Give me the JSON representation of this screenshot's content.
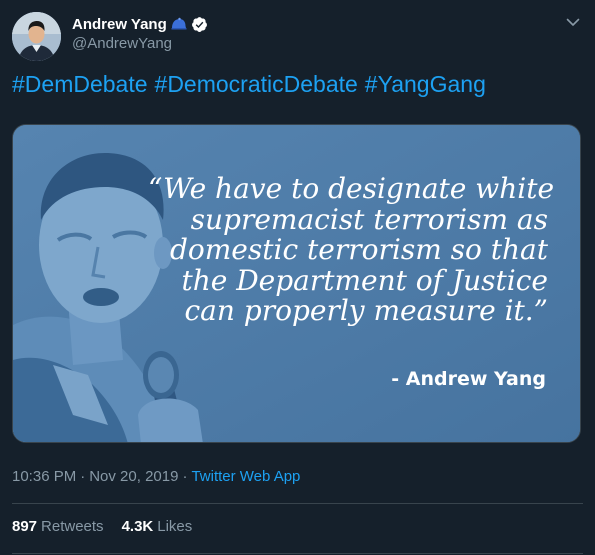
{
  "author": {
    "display_name": "Andrew Yang",
    "handle": "@AndrewYang",
    "badges": [
      "blue-hat-icon",
      "verified-icon"
    ]
  },
  "tweet": {
    "hashtags": [
      "#DemDebate",
      "#DemocraticDebate",
      "#YangGang"
    ]
  },
  "media": {
    "quote_lines": [
      "“We have to designate white",
      "supremacist terrorism as",
      "domestic terrorism so that",
      "the Department of Justice",
      "can properly measure it.”"
    ],
    "attribution": "- Andrew Yang",
    "background_color": "#4d7ba6"
  },
  "meta": {
    "time": "10:36 PM",
    "separator": "·",
    "date": "Nov 20, 2019",
    "source": "Twitter Web App"
  },
  "stats": {
    "retweets_count": "897",
    "retweets_label": "Retweets",
    "likes_count": "4.3K",
    "likes_label": "Likes"
  },
  "colors": {
    "background": "#15202b",
    "link": "#1da1f2",
    "secondary_text": "#8899a6",
    "border": "#38444d"
  }
}
